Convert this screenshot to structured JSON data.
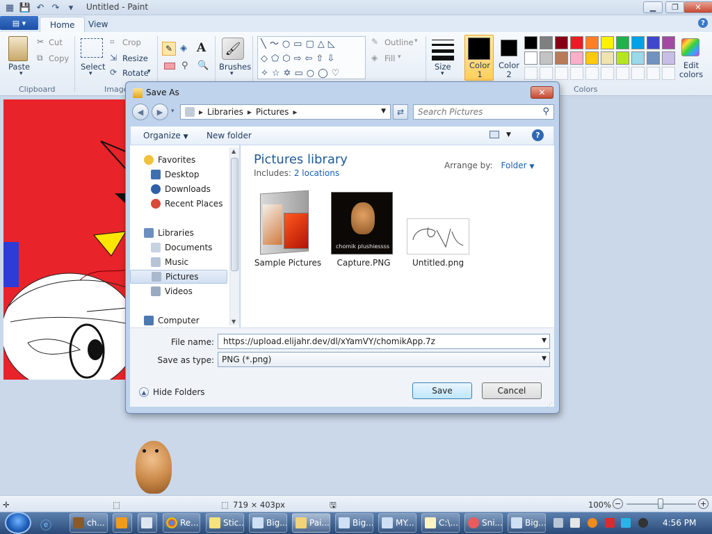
{
  "app": {
    "title": "Untitled - Paint",
    "tabs": [
      "Home",
      "View"
    ],
    "clipboard": {
      "paste": "Paste",
      "cut": "Cut",
      "copy": "Copy",
      "group": "Clipboard"
    },
    "image": {
      "select": "Select",
      "crop": "Crop",
      "resize": "Resize",
      "rotate": "Rotate",
      "group": "Image"
    },
    "tools": {
      "brushes": "Brushes"
    },
    "shapes": {
      "outline": "Outline",
      "fill": "Fill"
    },
    "size": "Size",
    "color1": "Color\n1",
    "color2": "Color\n2",
    "colors_group": "Colors",
    "edit_colors": "Edit\ncolors",
    "palette": [
      "#000000",
      "#7f7f7f",
      "#880015",
      "#ed1c24",
      "#ff7f27",
      "#fff200",
      "#22b14c",
      "#00a2e8",
      "#3f48cc",
      "#a349a4",
      "#ffffff",
      "#c3c3c3",
      "#b97a57",
      "#ffaec9",
      "#ffc90e",
      "#efe4b0",
      "#b5e61d",
      "#99d9ea",
      "#7092be",
      "#c8bfe7"
    ]
  },
  "status": {
    "dimensions": "719 × 403px",
    "zoom": "100%"
  },
  "dialog": {
    "title": "Save As",
    "breadcrumb": [
      "Libraries",
      "Pictures"
    ],
    "search_placeholder": "Search Pictures",
    "organize": "Organize",
    "new_folder": "New folder",
    "nav": {
      "favorites": "Favorites",
      "desktop": "Desktop",
      "downloads": "Downloads",
      "recent": "Recent Places",
      "libraries": "Libraries",
      "documents": "Documents",
      "music": "Music",
      "pictures": "Pictures",
      "videos": "Videos",
      "computer": "Computer"
    },
    "library_title": "Pictures library",
    "includes_label": "Includes:",
    "includes_link": "2 locations",
    "arrange_label": "Arrange by:",
    "arrange_value": "Folder",
    "files": [
      {
        "name": "Sample Pictures"
      },
      {
        "name": "Capture.PNG",
        "caption": "chomik plushiessss"
      },
      {
        "name": "Untitled.png"
      }
    ],
    "filename_label": "File name:",
    "filename_value": "https://upload.elijahr.dev/dl/xYamVY/chomikApp.7z",
    "savetype_label": "Save as type:",
    "savetype_value": "PNG (*.png)",
    "hide_folders": "Hide Folders",
    "save": "Save",
    "cancel": "Cancel"
  },
  "taskbar": {
    "items": [
      "ch...",
      "",
      "",
      "Re...",
      "Stic...",
      "Big...",
      "Pai...",
      "Big...",
      "MY...",
      "C:\\...",
      "Sni...",
      "Big..."
    ],
    "clock": "4:56 PM"
  }
}
